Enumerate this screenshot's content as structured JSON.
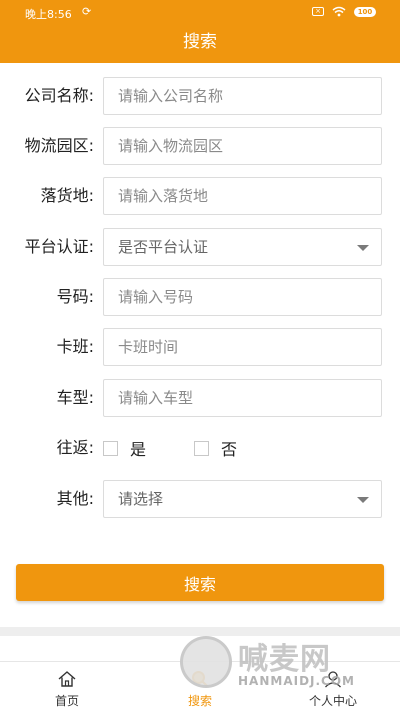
{
  "status_bar": {
    "time": "晚上8:56",
    "battery": "100"
  },
  "header": {
    "title": "搜索"
  },
  "form": {
    "company": {
      "label": "公司名称:",
      "placeholder": "请输入公司名称"
    },
    "park": {
      "label": "物流园区:",
      "placeholder": "请输入物流园区"
    },
    "destination": {
      "label": "落货地:",
      "placeholder": "请输入落货地"
    },
    "certification": {
      "label": "平台认证:",
      "value": "是否平台认证"
    },
    "number": {
      "label": "号码:",
      "placeholder": "请输入号码"
    },
    "shift": {
      "label": "卡班:",
      "placeholder": "卡班时间"
    },
    "vehicle": {
      "label": "车型:",
      "placeholder": "请输入车型"
    },
    "round_trip": {
      "label": "往返:",
      "options": [
        "是",
        "否"
      ]
    },
    "other": {
      "label": "其他:",
      "value": "请选择"
    }
  },
  "search_button": {
    "label": "搜索"
  },
  "nav": {
    "items": [
      {
        "label": "首页",
        "icon": "home-icon"
      },
      {
        "label": "搜索",
        "icon": "search-icon"
      },
      {
        "label": "个人中心",
        "icon": "person-icon"
      }
    ]
  },
  "watermark": {
    "text": "喊麦网",
    "sub": "HANMAIDJ.COM"
  },
  "colors": {
    "accent": "#f0960e"
  }
}
